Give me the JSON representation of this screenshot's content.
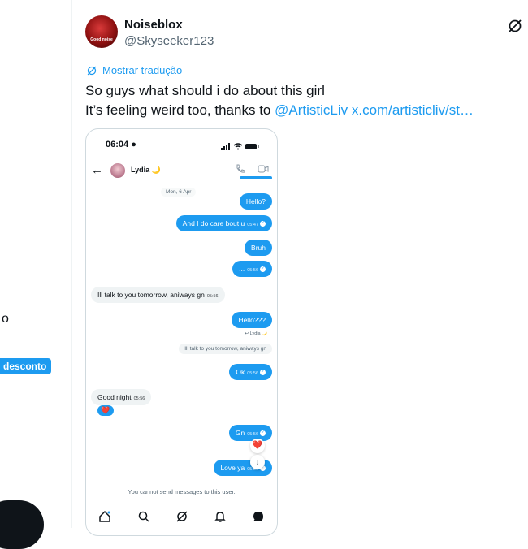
{
  "left_panel": {
    "text_fragment": "o",
    "badge": "desconto"
  },
  "tweet": {
    "author_name": "Noiseblox",
    "author_handle": "@Skyseeker123",
    "avatar_text": "Good noise",
    "translate_label": "Mostrar tradução",
    "line1": "So guys what should i do about this girl",
    "line2_prefix": "It’s feeling weird too, thanks to ",
    "mention": "@ArtisticLiv",
    "url": "x.com/artisticliv/st…",
    "grok_icon": "grok-icon"
  },
  "screenshot": {
    "status_time": "06:04",
    "contact_name": "Lydia 🌙",
    "date_chip": "Mon, 6 Apr",
    "messages": {
      "hello": "Hello?",
      "care": "And I do care bout u",
      "care_time": "05:47",
      "bruh": "Bruh",
      "dots": "...",
      "dots_time": "05:56",
      "ill_talk": "Ill talk to you tomorrow, aniways gn",
      "ill_talk_time": "05:56",
      "hello3": "Hello???",
      "reply_label": "Lydia 🌙",
      "reply_quote": "Ill talk to you tomorrow, aniways gn",
      "ok": "Ok",
      "ok_time": "05:56",
      "good_night": "Good night",
      "good_night_time": "05:56",
      "heart": "❤️",
      "gn": "Gn",
      "gn_time": "05:56",
      "love": "Love ya",
      "love_time": "05:56"
    },
    "notice": "You cannot send messages to this user."
  }
}
